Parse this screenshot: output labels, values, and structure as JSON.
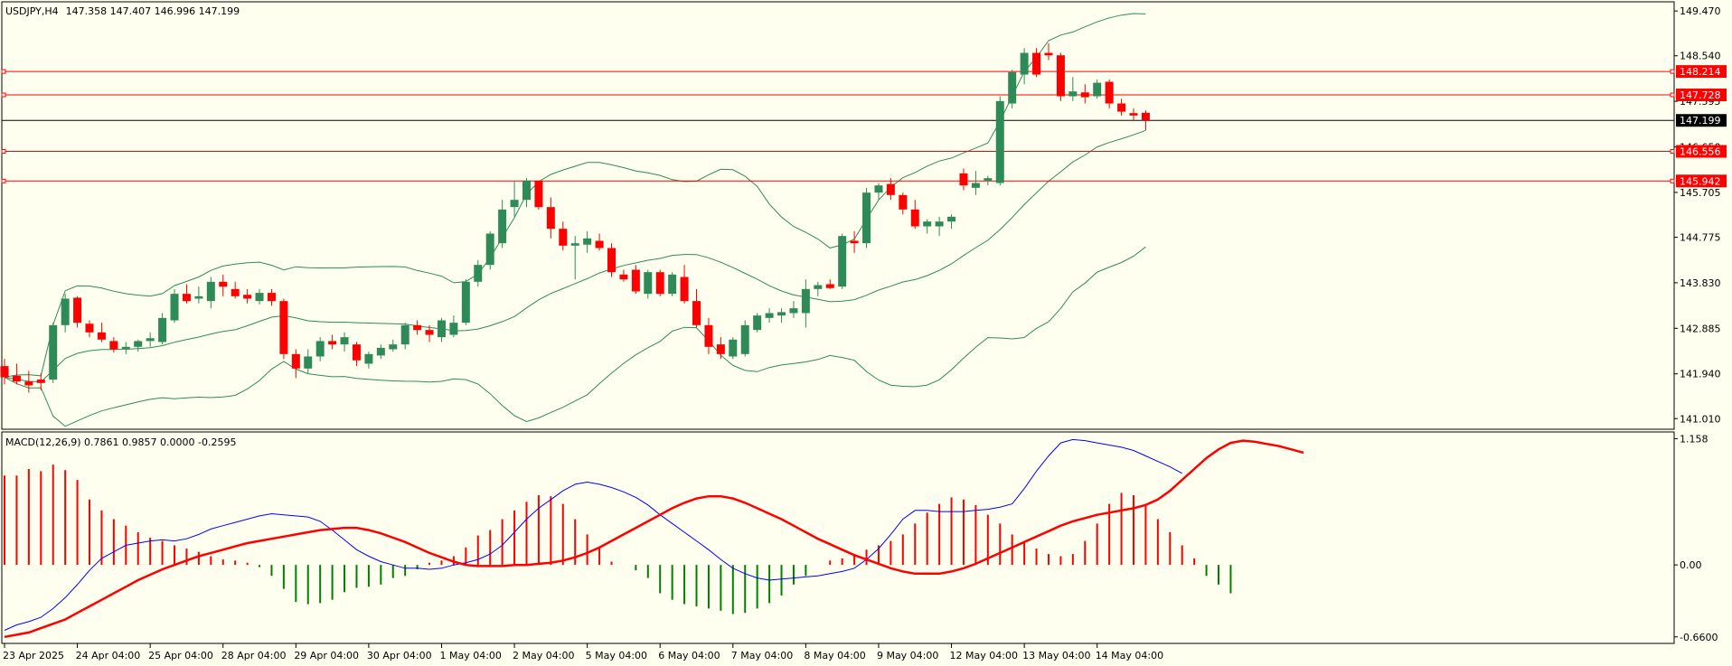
{
  "header": {
    "symbol": "USDJPY,H4",
    "ohlc": "147.358 147.407 146.996 147.199"
  },
  "macd_header": {
    "label": "MACD(12,26,9) 0.7861 0.9857 0.0000 -0.2595"
  },
  "colors": {
    "background": "#FFFFF0",
    "bull": "#2E8B57",
    "bear": "#FF0000",
    "bands": "#2E8B57",
    "level_lines": "#FF0000",
    "macd_line": "#0000FF",
    "signal_line": "#FF0000"
  },
  "chart_data": [
    {
      "type": "candlestick",
      "title": "USDJPY,H4",
      "x_tick_labels": [
        "23 Apr 2025",
        "24 Apr 04:00",
        "25 Apr 04:00",
        "28 Apr 04:00",
        "29 Apr 04:00",
        "30 Apr 04:00",
        "1 May 04:00",
        "2 May 04:00",
        "5 May 04:00",
        "6 May 04:00",
        "7 May 04:00",
        "8 May 04:00",
        "9 May 04:00",
        "12 May 04:00",
        "13 May 04:00",
        "14 May 04:00"
      ],
      "y_tick_labels": [
        "149.470",
        "148.540",
        "147.595",
        "146.650",
        "145.705",
        "144.775",
        "143.830",
        "142.885",
        "141.940",
        "141.010"
      ],
      "ylim": [
        140.79,
        149.66
      ],
      "current_price": "147.199",
      "horizontal_levels": [
        "148.214",
        "147.728",
        "146.556",
        "145.942"
      ],
      "candles": [
        [
          142.1,
          142.25,
          141.72,
          141.87
        ],
        [
          141.9,
          142.15,
          141.72,
          141.78
        ],
        [
          141.78,
          142.0,
          141.55,
          141.7
        ],
        [
          141.82,
          141.95,
          141.6,
          141.75
        ],
        [
          141.82,
          143.0,
          141.75,
          142.95
        ],
        [
          142.95,
          143.6,
          142.8,
          143.5
        ],
        [
          143.52,
          143.55,
          142.9,
          143.0
        ],
        [
          142.98,
          143.05,
          142.7,
          142.8
        ],
        [
          142.8,
          143.0,
          142.6,
          142.65
        ],
        [
          142.62,
          142.7,
          142.38,
          142.45
        ],
        [
          142.46,
          142.6,
          142.35,
          142.5
        ],
        [
          142.5,
          142.65,
          142.4,
          142.62
        ],
        [
          142.62,
          142.8,
          142.5,
          142.68
        ],
        [
          142.6,
          143.2,
          142.55,
          143.1
        ],
        [
          143.05,
          143.7,
          143.0,
          143.6
        ],
        [
          143.6,
          143.8,
          143.4,
          143.45
        ],
        [
          143.5,
          143.75,
          143.4,
          143.55
        ],
        [
          143.45,
          143.95,
          143.3,
          143.85
        ],
        [
          143.85,
          144.0,
          143.55,
          143.75
        ],
        [
          143.7,
          143.85,
          143.5,
          143.55
        ],
        [
          143.58,
          143.7,
          143.4,
          143.5
        ],
        [
          143.45,
          143.7,
          143.38,
          143.62
        ],
        [
          143.62,
          143.7,
          143.35,
          143.45
        ],
        [
          143.45,
          143.5,
          142.25,
          142.35
        ],
        [
          142.35,
          142.45,
          141.85,
          142.05
        ],
        [
          142.05,
          142.45,
          141.95,
          142.3
        ],
        [
          142.3,
          142.7,
          142.2,
          142.62
        ],
        [
          142.62,
          142.75,
          142.45,
          142.55
        ],
        [
          142.55,
          142.8,
          142.4,
          142.7
        ],
        [
          142.55,
          142.6,
          142.1,
          142.22
        ],
        [
          142.15,
          142.4,
          142.05,
          142.35
        ],
        [
          142.32,
          142.55,
          142.25,
          142.48
        ],
        [
          142.45,
          142.65,
          142.4,
          142.55
        ],
        [
          142.55,
          143.0,
          142.45,
          142.95
        ],
        [
          142.95,
          143.05,
          142.75,
          142.85
        ],
        [
          142.85,
          142.95,
          142.6,
          142.75
        ],
        [
          142.7,
          143.1,
          142.6,
          143.05
        ],
        [
          142.75,
          143.15,
          142.7,
          143.0
        ],
        [
          143.0,
          143.9,
          142.95,
          143.85
        ],
        [
          143.85,
          144.3,
          143.75,
          144.2
        ],
        [
          144.2,
          144.9,
          144.1,
          144.85
        ],
        [
          144.65,
          145.55,
          144.55,
          145.35
        ],
        [
          145.4,
          145.95,
          145.2,
          145.55
        ],
        [
          145.55,
          146.0,
          145.4,
          145.95
        ],
        [
          145.95,
          145.95,
          145.35,
          145.4
        ],
        [
          145.4,
          145.6,
          144.75,
          144.95
        ],
        [
          144.95,
          145.1,
          144.5,
          144.6
        ],
        [
          144.6,
          144.8,
          143.9,
          144.65
        ],
        [
          144.62,
          144.9,
          144.45,
          144.75
        ],
        [
          144.7,
          144.85,
          144.5,
          144.55
        ],
        [
          144.55,
          144.65,
          143.95,
          144.05
        ],
        [
          144.0,
          144.1,
          143.85,
          143.9
        ],
        [
          144.1,
          144.2,
          143.6,
          143.65
        ],
        [
          143.6,
          144.1,
          143.5,
          144.05
        ],
        [
          144.05,
          144.1,
          143.55,
          143.6
        ],
        [
          143.6,
          144.05,
          143.55,
          144.0
        ],
        [
          143.95,
          144.2,
          143.4,
          143.45
        ],
        [
          143.45,
          143.7,
          142.9,
          142.95
        ],
        [
          142.95,
          143.1,
          142.35,
          142.5
        ],
        [
          142.55,
          142.7,
          142.25,
          142.35
        ],
        [
          142.3,
          142.7,
          142.25,
          142.65
        ],
        [
          142.35,
          143.05,
          142.3,
          142.95
        ],
        [
          142.85,
          143.2,
          142.8,
          143.15
        ],
        [
          143.1,
          143.3,
          143.0,
          143.2
        ],
        [
          143.15,
          143.3,
          143.0,
          143.22
        ],
        [
          143.2,
          143.45,
          143.1,
          143.3
        ],
        [
          143.2,
          143.9,
          142.9,
          143.7
        ],
        [
          143.7,
          143.85,
          143.55,
          143.78
        ],
        [
          143.8,
          143.9,
          143.7,
          143.72
        ],
        [
          143.75,
          144.85,
          143.7,
          144.8
        ],
        [
          144.7,
          144.9,
          144.45,
          144.65
        ],
        [
          144.65,
          145.8,
          144.55,
          145.7
        ],
        [
          145.7,
          145.9,
          145.55,
          145.85
        ],
        [
          145.88,
          146.0,
          145.55,
          145.65
        ],
        [
          145.65,
          145.7,
          145.25,
          145.35
        ],
        [
          145.35,
          145.55,
          144.95,
          145.0
        ],
        [
          145.0,
          145.15,
          144.85,
          145.1
        ],
        [
          145.0,
          145.2,
          144.8,
          145.1
        ],
        [
          145.1,
          145.25,
          144.95,
          145.2
        ],
        [
          146.1,
          146.2,
          145.75,
          145.85
        ],
        [
          145.8,
          146.15,
          145.65,
          145.9
        ],
        [
          145.95,
          146.05,
          145.85,
          146.0
        ],
        [
          145.9,
          147.7,
          145.85,
          147.6
        ],
        [
          147.55,
          148.25,
          147.45,
          148.2
        ],
        [
          148.15,
          148.7,
          147.95,
          148.6
        ],
        [
          148.6,
          148.7,
          148.1,
          148.15
        ],
        [
          148.6,
          148.8,
          148.45,
          148.55
        ],
        [
          148.55,
          148.6,
          147.6,
          147.7
        ],
        [
          147.7,
          148.1,
          147.6,
          147.8
        ],
        [
          147.78,
          147.95,
          147.55,
          147.68
        ],
        [
          147.7,
          148.05,
          147.65,
          147.98
        ],
        [
          148.0,
          148.05,
          147.45,
          147.55
        ],
        [
          147.55,
          147.65,
          147.3,
          147.38
        ],
        [
          147.35,
          147.45,
          147.2,
          147.3
        ],
        [
          147.358,
          147.407,
          146.996,
          147.199
        ]
      ]
    },
    {
      "type": "line",
      "title": "MACD(12,26,9)",
      "y_tick_labels": [
        "1.158",
        "0.00",
        "-0.6600"
      ],
      "ylim": [
        -0.72,
        1.22
      ],
      "series": [
        {
          "values": [
            -0.6,
            -0.55,
            -0.52,
            -0.48,
            -0.4,
            -0.3,
            -0.18,
            -0.05,
            0.06,
            0.12,
            0.18,
            0.2,
            0.22,
            0.23,
            0.22,
            0.24,
            0.28,
            0.33,
            0.36,
            0.39,
            0.42,
            0.45,
            0.47,
            0.46,
            0.45,
            0.44,
            0.4,
            0.32,
            0.23,
            0.14,
            0.08,
            0.03,
            0.0,
            -0.03,
            -0.03,
            -0.04,
            -0.03,
            0.0,
            0.02,
            0.05,
            0.1,
            0.18,
            0.3,
            0.42,
            0.52,
            0.6,
            0.68,
            0.74,
            0.76,
            0.74,
            0.71,
            0.67,
            0.62,
            0.55,
            0.46,
            0.38,
            0.3,
            0.22,
            0.14,
            0.05,
            -0.03,
            -0.08,
            -0.12,
            -0.14,
            -0.13,
            -0.12,
            -0.11,
            -0.1,
            -0.08,
            -0.06,
            -0.03,
            0.05,
            0.15,
            0.28,
            0.42,
            0.5,
            0.5,
            0.49,
            0.49,
            0.49,
            0.5,
            0.51,
            0.53,
            0.56,
            0.7,
            0.86,
            1.0,
            1.12,
            1.15,
            1.14,
            1.12,
            1.1,
            1.08,
            1.05,
            1.0,
            0.95,
            0.9,
            0.84
          ]
        },
        {
          "values": [
            -0.66,
            -0.64,
            -0.62,
            -0.58,
            -0.54,
            -0.5,
            -0.44,
            -0.38,
            -0.32,
            -0.26,
            -0.2,
            -0.14,
            -0.09,
            -0.04,
            0.0,
            0.04,
            0.08,
            0.11,
            0.14,
            0.17,
            0.2,
            0.22,
            0.24,
            0.26,
            0.28,
            0.3,
            0.32,
            0.33,
            0.34,
            0.34,
            0.32,
            0.29,
            0.25,
            0.21,
            0.16,
            0.11,
            0.07,
            0.03,
            0.0,
            -0.01,
            -0.01,
            -0.01,
            0.0,
            0.0,
            0.01,
            0.02,
            0.04,
            0.07,
            0.11,
            0.16,
            0.22,
            0.28,
            0.34,
            0.4,
            0.46,
            0.52,
            0.57,
            0.61,
            0.63,
            0.63,
            0.61,
            0.57,
            0.52,
            0.47,
            0.42,
            0.36,
            0.3,
            0.24,
            0.19,
            0.14,
            0.09,
            0.05,
            0.01,
            -0.03,
            -0.06,
            -0.08,
            -0.08,
            -0.08,
            -0.06,
            -0.03,
            0.01,
            0.06,
            0.11,
            0.16,
            0.21,
            0.26,
            0.31,
            0.36,
            0.4,
            0.43,
            0.46,
            0.48,
            0.5,
            0.52,
            0.55,
            0.6,
            0.68,
            0.78,
            0.88,
            0.98,
            1.06,
            1.12,
            1.14,
            1.13,
            1.11,
            1.09,
            1.06,
            1.03
          ]
        }
      ],
      "histogram": [
        0.82,
        0.82,
        0.88,
        0.86,
        0.92,
        0.87,
        0.78,
        0.6,
        0.5,
        0.42,
        0.36,
        0.3,
        0.25,
        0.22,
        0.18,
        0.15,
        0.12,
        0.08,
        0.05,
        0.04,
        0.02,
        -0.02,
        -0.1,
        -0.22,
        -0.34,
        -0.36,
        -0.35,
        -0.32,
        -0.25,
        -0.21,
        -0.2,
        -0.18,
        -0.12,
        -0.1,
        -0.04,
        0.02,
        0.04,
        0.08,
        0.16,
        0.27,
        0.32,
        0.42,
        0.5,
        0.58,
        0.64,
        0.63,
        0.56,
        0.42,
        0.28,
        0.16,
        0.03,
        0.0,
        -0.05,
        -0.12,
        -0.26,
        -0.32,
        -0.36,
        -0.38,
        -0.4,
        -0.42,
        -0.45,
        -0.44,
        -0.4,
        -0.35,
        -0.28,
        -0.18,
        -0.1,
        0.0,
        0.04,
        0.06,
        0.1,
        0.14,
        0.18,
        0.22,
        0.28,
        0.38,
        0.48,
        0.56,
        0.62,
        0.6,
        0.55,
        0.46,
        0.38,
        0.28,
        0.2,
        0.15,
        0.1,
        0.08,
        0.1,
        0.22,
        0.38,
        0.56,
        0.66,
        0.64,
        0.54,
        0.42,
        0.3,
        0.18,
        0.06,
        -0.1,
        -0.18,
        -0.26
      ]
    }
  ]
}
